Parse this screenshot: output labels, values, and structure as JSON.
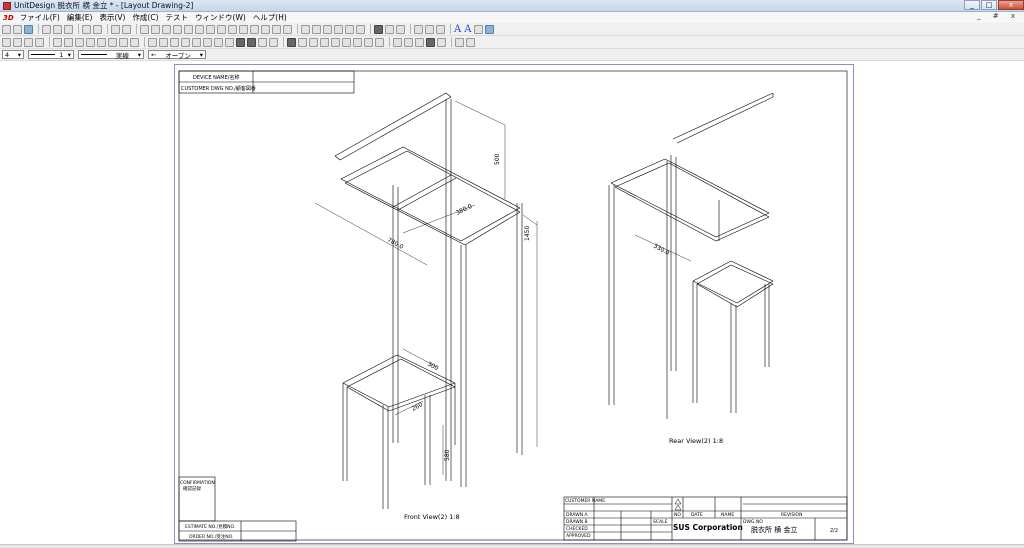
{
  "window": {
    "title": "UnitDesign 脱衣所  横  金立 * - [Layout Drawing-2]",
    "controls": [
      "_",
      "□",
      "x"
    ]
  },
  "menu": {
    "logo": "3D",
    "items": [
      "ファイル(F)",
      "編集(E)",
      "表示(V)",
      "作成(C)",
      "テスト",
      "ウィンドウ(W)",
      "ヘルプ(H)"
    ],
    "mdi_controls": "_ # x"
  },
  "style_bar": {
    "layer": "4",
    "line_weight": "1",
    "line_type": "実線",
    "fill": "オープン"
  },
  "drawing": {
    "header": {
      "device_name_label": "DEVICE NAME/名称",
      "customer_dwg_label": "CUSTOMER DWG NO./顧客図番"
    },
    "front_view_label": "Front View(2)  1:8",
    "rear_view_label": "Rear View(2)  1:8",
    "dimensions": {
      "front_top": "500",
      "front_height": "1450",
      "front_depth": "380.0",
      "front_width": "780.0",
      "stool_w": "300",
      "stool_d": "260",
      "stool_h": "580",
      "rear_width": "330.0"
    },
    "left_block": {
      "confirmation": "CONFIRMATION",
      "confirmation_jp": "確認記録",
      "estimate": "ESTIMATE NO./見積NO.",
      "order": "ORDER NO./受注NO."
    },
    "title_block": {
      "customer_name": "CUSTOMER NAME",
      "drawn_a": "DRAWN A",
      "drawn_b": "DRAWN B",
      "checked": "CHECKED",
      "approved": "APPROVED",
      "no": "NO",
      "date": "DATE",
      "name": "NAME",
      "revision": "REVISION",
      "scale": "SCALE",
      "company": "SUS Corporation",
      "dwg_no_label": "DWG.NO",
      "dwg_name": "脱衣所  横  金立",
      "sheet": "2/2"
    }
  }
}
